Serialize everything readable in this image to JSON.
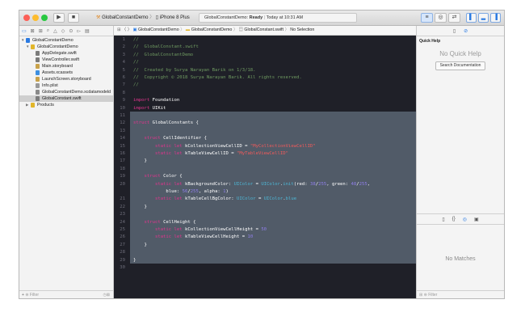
{
  "toolbar": {
    "scheme_target": "GlobalConstantDemo",
    "scheme_device": "iPhone 8 Plus",
    "status_project": "GlobalConstantDemo:",
    "status_state": "Ready",
    "status_time": "Today at 10:31 AM",
    "run_icon": "play-icon",
    "stop_icon": "stop-icon"
  },
  "navigator": {
    "items": [
      {
        "label": "GlobalConstantDemo",
        "indent": 0,
        "kind": "project",
        "disclosure": "▼"
      },
      {
        "label": "GlobalConstantDemo",
        "indent": 1,
        "kind": "folder",
        "disclosure": "▼"
      },
      {
        "label": "AppDelegate.swift",
        "indent": 2,
        "kind": "swift",
        "disclosure": ""
      },
      {
        "label": "ViewController.swift",
        "indent": 2,
        "kind": "swift",
        "disclosure": ""
      },
      {
        "label": "Main.storyboard",
        "indent": 2,
        "kind": "storyboard",
        "disclosure": ""
      },
      {
        "label": "Assets.xcassets",
        "indent": 2,
        "kind": "assets",
        "disclosure": ""
      },
      {
        "label": "LaunchScreen.storyboard",
        "indent": 2,
        "kind": "storyboard",
        "disclosure": ""
      },
      {
        "label": "Info.plist",
        "indent": 2,
        "kind": "plist",
        "disclosure": ""
      },
      {
        "label": "GlobalConstantDemo.xcdatamodeld",
        "indent": 2,
        "kind": "datamodel",
        "disclosure": ""
      },
      {
        "label": "GlobalConstant.swift",
        "indent": 2,
        "kind": "swift",
        "disclosure": "",
        "selected": true
      },
      {
        "label": "Products",
        "indent": 1,
        "kind": "folder",
        "disclosure": "▶"
      }
    ],
    "filter_placeholder": "Filter"
  },
  "jumpbar": {
    "crumbs": [
      "GlobalConstantDemo",
      "GlobalConstantDemo",
      "GlobalConstant.swift",
      "No Selection"
    ]
  },
  "editor": {
    "lines": [
      {
        "n": "1",
        "t": [
          [
            "//",
            "com"
          ]
        ]
      },
      {
        "n": "2",
        "t": [
          [
            "//  GlobalConstant.swift",
            "com"
          ]
        ]
      },
      {
        "n": "3",
        "t": [
          [
            "//  GlobalConstantDemo",
            "com"
          ]
        ]
      },
      {
        "n": "4",
        "t": [
          [
            "//",
            "com"
          ]
        ]
      },
      {
        "n": "5",
        "t": [
          [
            "//  Created by Surya Narayan Barik on 1/3/18.",
            "com"
          ]
        ]
      },
      {
        "n": "6",
        "t": [
          [
            "//  Copyright © 2018 Surya Narayan Barik. All rights reserved.",
            "com"
          ]
        ]
      },
      {
        "n": "7",
        "t": [
          [
            "//",
            "com"
          ]
        ]
      },
      {
        "n": "8",
        "t": []
      },
      {
        "n": "9",
        "t": [
          [
            "import",
            "kw"
          ],
          [
            " Foundation",
            "pl"
          ]
        ]
      },
      {
        "n": "10",
        "t": [
          [
            "import",
            "kw"
          ],
          [
            " UIKit",
            "pl"
          ]
        ]
      },
      {
        "n": "11",
        "t": []
      },
      {
        "n": "12",
        "t": [
          [
            "struct",
            "kw"
          ],
          [
            " GlobalConstants {",
            "pl"
          ]
        ]
      },
      {
        "n": "13",
        "t": []
      },
      {
        "n": "14",
        "t": [
          [
            "    ",
            "pl"
          ],
          [
            "struct",
            "kw"
          ],
          [
            " CellIdentifier {",
            "pl"
          ]
        ]
      },
      {
        "n": "15",
        "t": [
          [
            "        ",
            "pl"
          ],
          [
            "static let",
            "kw"
          ],
          [
            " kCollectionViewCellID = ",
            "pl"
          ],
          [
            "\"MyCollectionViewCellID\"",
            "str"
          ]
        ]
      },
      {
        "n": "16",
        "t": [
          [
            "        ",
            "pl"
          ],
          [
            "static let",
            "kw"
          ],
          [
            " kTableViewCellID = ",
            "pl"
          ],
          [
            "\"MyTableViewCellID\"",
            "str"
          ]
        ]
      },
      {
        "n": "17",
        "t": [
          [
            "    }",
            "pl"
          ]
        ]
      },
      {
        "n": "18",
        "t": []
      },
      {
        "n": "19",
        "t": [
          [
            "    ",
            "pl"
          ],
          [
            "struct",
            "kw"
          ],
          [
            " Color {",
            "pl"
          ]
        ]
      },
      {
        "n": "20",
        "t": [
          [
            "        ",
            "pl"
          ],
          [
            "static let",
            "kw"
          ],
          [
            " kBackgroundColor: ",
            "pl"
          ],
          [
            "UIColor",
            "type"
          ],
          [
            " = ",
            "pl"
          ],
          [
            "UIColor",
            "type"
          ],
          [
            ".",
            "pl"
          ],
          [
            "init",
            "type"
          ],
          [
            "(red: ",
            "pl"
          ],
          [
            "38",
            "num"
          ],
          [
            "/",
            "pl"
          ],
          [
            "255",
            "num"
          ],
          [
            ", green: ",
            "pl"
          ],
          [
            "48",
            "num"
          ],
          [
            "/",
            "pl"
          ],
          [
            "255",
            "num"
          ],
          [
            ",",
            "pl"
          ]
        ]
      },
      {
        "n": "",
        "t": [
          [
            "            blue: ",
            "pl"
          ],
          [
            "56",
            "num"
          ],
          [
            "/",
            "pl"
          ],
          [
            "255",
            "num"
          ],
          [
            ", alpha: ",
            "pl"
          ],
          [
            "1",
            "num"
          ],
          [
            ")",
            "pl"
          ]
        ]
      },
      {
        "n": "21",
        "t": [
          [
            "        ",
            "pl"
          ],
          [
            "static let",
            "kw"
          ],
          [
            " kTableCellBgColor: ",
            "pl"
          ],
          [
            "UIColor",
            "type"
          ],
          [
            " = ",
            "pl"
          ],
          [
            "UIColor",
            "type"
          ],
          [
            ".",
            "pl"
          ],
          [
            "blue",
            "type"
          ]
        ]
      },
      {
        "n": "22",
        "t": [
          [
            "    }",
            "pl"
          ]
        ]
      },
      {
        "n": "23",
        "t": []
      },
      {
        "n": "24",
        "t": [
          [
            "    ",
            "pl"
          ],
          [
            "struct",
            "kw"
          ],
          [
            " CellHeight {",
            "pl"
          ]
        ]
      },
      {
        "n": "25",
        "t": [
          [
            "        ",
            "pl"
          ],
          [
            "static let",
            "kw"
          ],
          [
            " kCollectionViewCellHeight = ",
            "pl"
          ],
          [
            "50",
            "num"
          ]
        ]
      },
      {
        "n": "26",
        "t": [
          [
            "        ",
            "pl"
          ],
          [
            "static let",
            "kw"
          ],
          [
            " kTableViewCellHeight = ",
            "pl"
          ],
          [
            "10",
            "num"
          ]
        ]
      },
      {
        "n": "27",
        "t": [
          [
            "    }",
            "pl"
          ]
        ]
      },
      {
        "n": "28",
        "t": []
      },
      {
        "n": "29",
        "t": [
          [
            "}",
            "pl"
          ]
        ]
      },
      {
        "n": "30",
        "t": []
      }
    ]
  },
  "inspector": {
    "quick_help_title": "Quick Help",
    "no_quick_help": "No Quick Help",
    "search_docs": "Search Documentation",
    "no_matches": "No Matches",
    "filter_placeholder": "Filter"
  },
  "colors": {
    "editor_bg": "#1f2028",
    "selection": "#5a6673",
    "comment": "#6f9a61",
    "keyword": "#e3348e",
    "string": "#f25b5b",
    "type": "#4db7d6",
    "number": "#8f7fe9",
    "accent": "#2a7ae2"
  }
}
